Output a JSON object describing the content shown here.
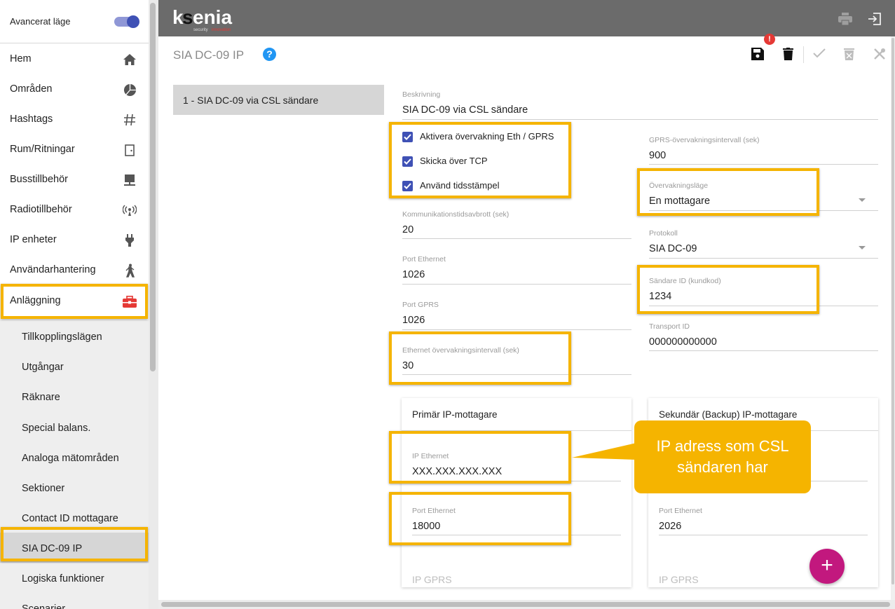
{
  "sidebar": {
    "advanced_mode_label": "Avancerat läge",
    "items": [
      {
        "label": "Hem",
        "icon": "home-icon"
      },
      {
        "label": "Områden",
        "icon": "pie-chart-icon"
      },
      {
        "label": "Hashtags",
        "icon": "hashtag-icon"
      },
      {
        "label": "Rum/Ritningar",
        "icon": "door-icon"
      },
      {
        "label": "Busstillbehör",
        "icon": "bus-device-icon"
      },
      {
        "label": "Radiotillbehör",
        "icon": "radio-signal-icon"
      },
      {
        "label": "IP enheter",
        "icon": "plug-icon"
      },
      {
        "label": "Användarhantering",
        "icon": "walking-person-icon"
      },
      {
        "label": "Anläggning",
        "icon": "toolbox-icon"
      }
    ],
    "sub_items": [
      {
        "label": "Tillkopplingslägen"
      },
      {
        "label": "Utgångar"
      },
      {
        "label": "Räknare"
      },
      {
        "label": "Special balans."
      },
      {
        "label": "Analoga mätområden"
      },
      {
        "label": "Sektioner"
      },
      {
        "label": "Contact ID mottagare"
      },
      {
        "label": "SIA DC-09 IP"
      },
      {
        "label": "Logiska funktioner"
      },
      {
        "label": "Scenarier"
      }
    ],
    "active_sub_item": "SIA DC-09 IP"
  },
  "topbar": {
    "logo_text": "ksenia",
    "logo_tagline": "security innovation",
    "icons": [
      "print-icon",
      "logout-icon"
    ]
  },
  "page": {
    "title": "SIA DC-09 IP",
    "alert_badge": "!",
    "list": [
      {
        "label": "1 - SIA DC-09 via CSL sändare"
      }
    ]
  },
  "form": {
    "description": {
      "label": "Beskrivning",
      "value": "SIA DC-09 via CSL sändare"
    },
    "checkboxes": [
      {
        "label": "Aktivera övervakning Eth / GPRS",
        "checked": true
      },
      {
        "label": "Skicka över TCP",
        "checked": true
      },
      {
        "label": "Använd tidsstämpel",
        "checked": true
      }
    ],
    "gprs_interval": {
      "label": "GPRS-övervakningsintervall (sek)",
      "value": "900"
    },
    "monitoring_mode": {
      "label": "Övervakningsläge",
      "value": "En mottagare"
    },
    "comm_timeout": {
      "label": "Kommunikationstidsavbrott (sek)",
      "value": "20"
    },
    "protocol": {
      "label": "Protokoll",
      "value": "SIA DC-09"
    },
    "port_ethernet": {
      "label": "Port Ethernet",
      "value": "1026"
    },
    "sender_id": {
      "label": "Sändare ID (kundkod)",
      "value": "1234"
    },
    "port_gprs": {
      "label": "Port GPRS",
      "value": "1026"
    },
    "transport_id": {
      "label": "Transport ID",
      "value": "000000000000"
    },
    "eth_interval": {
      "label": "Ethernet övervakningsintervall (sek)",
      "value": "30"
    }
  },
  "primary_receiver": {
    "title": "Primär IP-mottagare",
    "ip_ethernet": {
      "label": "IP Ethernet",
      "value": "XXX.XXX.XXX.XXX"
    },
    "port_ethernet": {
      "label": "Port Ethernet",
      "value": "18000"
    },
    "ip_gprs": {
      "label": "IP GPRS"
    }
  },
  "secondary_receiver": {
    "title": "Sekundär (Backup) IP-mottagare",
    "port_ethernet": {
      "label": "Port Ethernet",
      "value": "2026"
    },
    "ip_gprs": {
      "label": "IP GPRS"
    }
  },
  "callout": {
    "line1": "IP adress som CSL",
    "line2": "sändaren har"
  },
  "fab": {
    "label": "+"
  },
  "colors": {
    "highlight": "#f5b400",
    "accent": "#3f51b5",
    "fab": "#c2187e",
    "help": "#2196f3",
    "alert": "#e53935",
    "topbar": "#6b6b6b"
  }
}
